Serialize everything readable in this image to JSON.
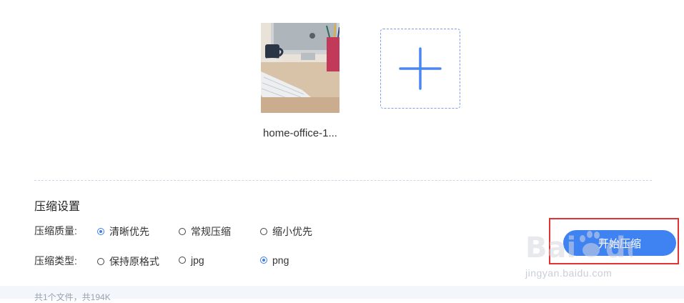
{
  "upload": {
    "file_name": "home-office-1...",
    "thumbnail_description_icon": "photo-thumbnail",
    "add_icon": "plus-icon"
  },
  "settings": {
    "title": "压缩设置",
    "quality": {
      "label": "压缩质量:",
      "options": [
        "清晰优先",
        "常规压缩",
        "缩小优先"
      ],
      "selected": "清晰优先"
    },
    "type": {
      "label": "压缩类型:",
      "options": [
        "保持原格式",
        "jpg",
        "png"
      ],
      "selected": "png"
    }
  },
  "actions": {
    "start_label": "开始压缩"
  },
  "watermark": {
    "brand": "Baidu",
    "url": "jingyan.baidu.com"
  },
  "footer": {
    "summary": "共1个文件，共194K"
  },
  "colors": {
    "accent": "#3f82f2",
    "highlight_box": "#e23232",
    "dashed_border": "#7f9ff0"
  }
}
